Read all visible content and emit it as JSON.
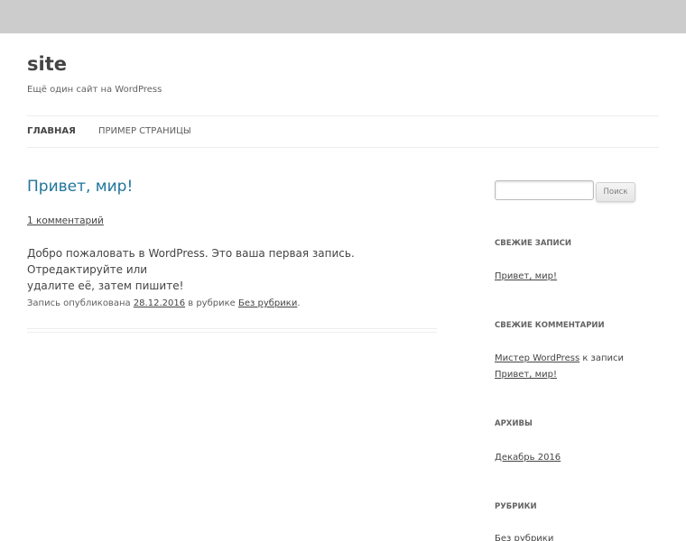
{
  "site": {
    "title": "site",
    "description": "Ещё один сайт на WordPress"
  },
  "nav": {
    "items": [
      {
        "label": "Главная"
      },
      {
        "label": "Пример страницы"
      }
    ]
  },
  "post": {
    "title": "Привет, мир!",
    "comments_link": "1 комментарий",
    "content_line1": "Добро пожаловать в WordPress. Это ваша первая запись. Отредактируйте или",
    "content_line2": "удалите её, затем пишите!",
    "meta_prefix": "Запись опубликована ",
    "meta_date": "28.12.2016",
    "meta_middle": " в рубрике ",
    "meta_category": "Без рубрики",
    "meta_suffix": "."
  },
  "sidebar": {
    "search": {
      "placeholder": "",
      "button_label": "Поиск"
    },
    "recent_posts": {
      "title": "Свежие записи",
      "items": [
        "Привет, мир!"
      ]
    },
    "recent_comments": {
      "title": "Свежие комментарии",
      "author": "Мистер WordPress",
      "connector": " к записи",
      "post": "Привет, мир!"
    },
    "archives": {
      "title": "Архивы",
      "items": [
        "Декабрь 2016"
      ]
    },
    "categories": {
      "title": "Рубрики",
      "items": [
        "Без рубрики"
      ]
    }
  },
  "colors": {
    "background": "#cccccc",
    "page": "#ffffff",
    "link": "#21759b",
    "text": "#444444"
  }
}
